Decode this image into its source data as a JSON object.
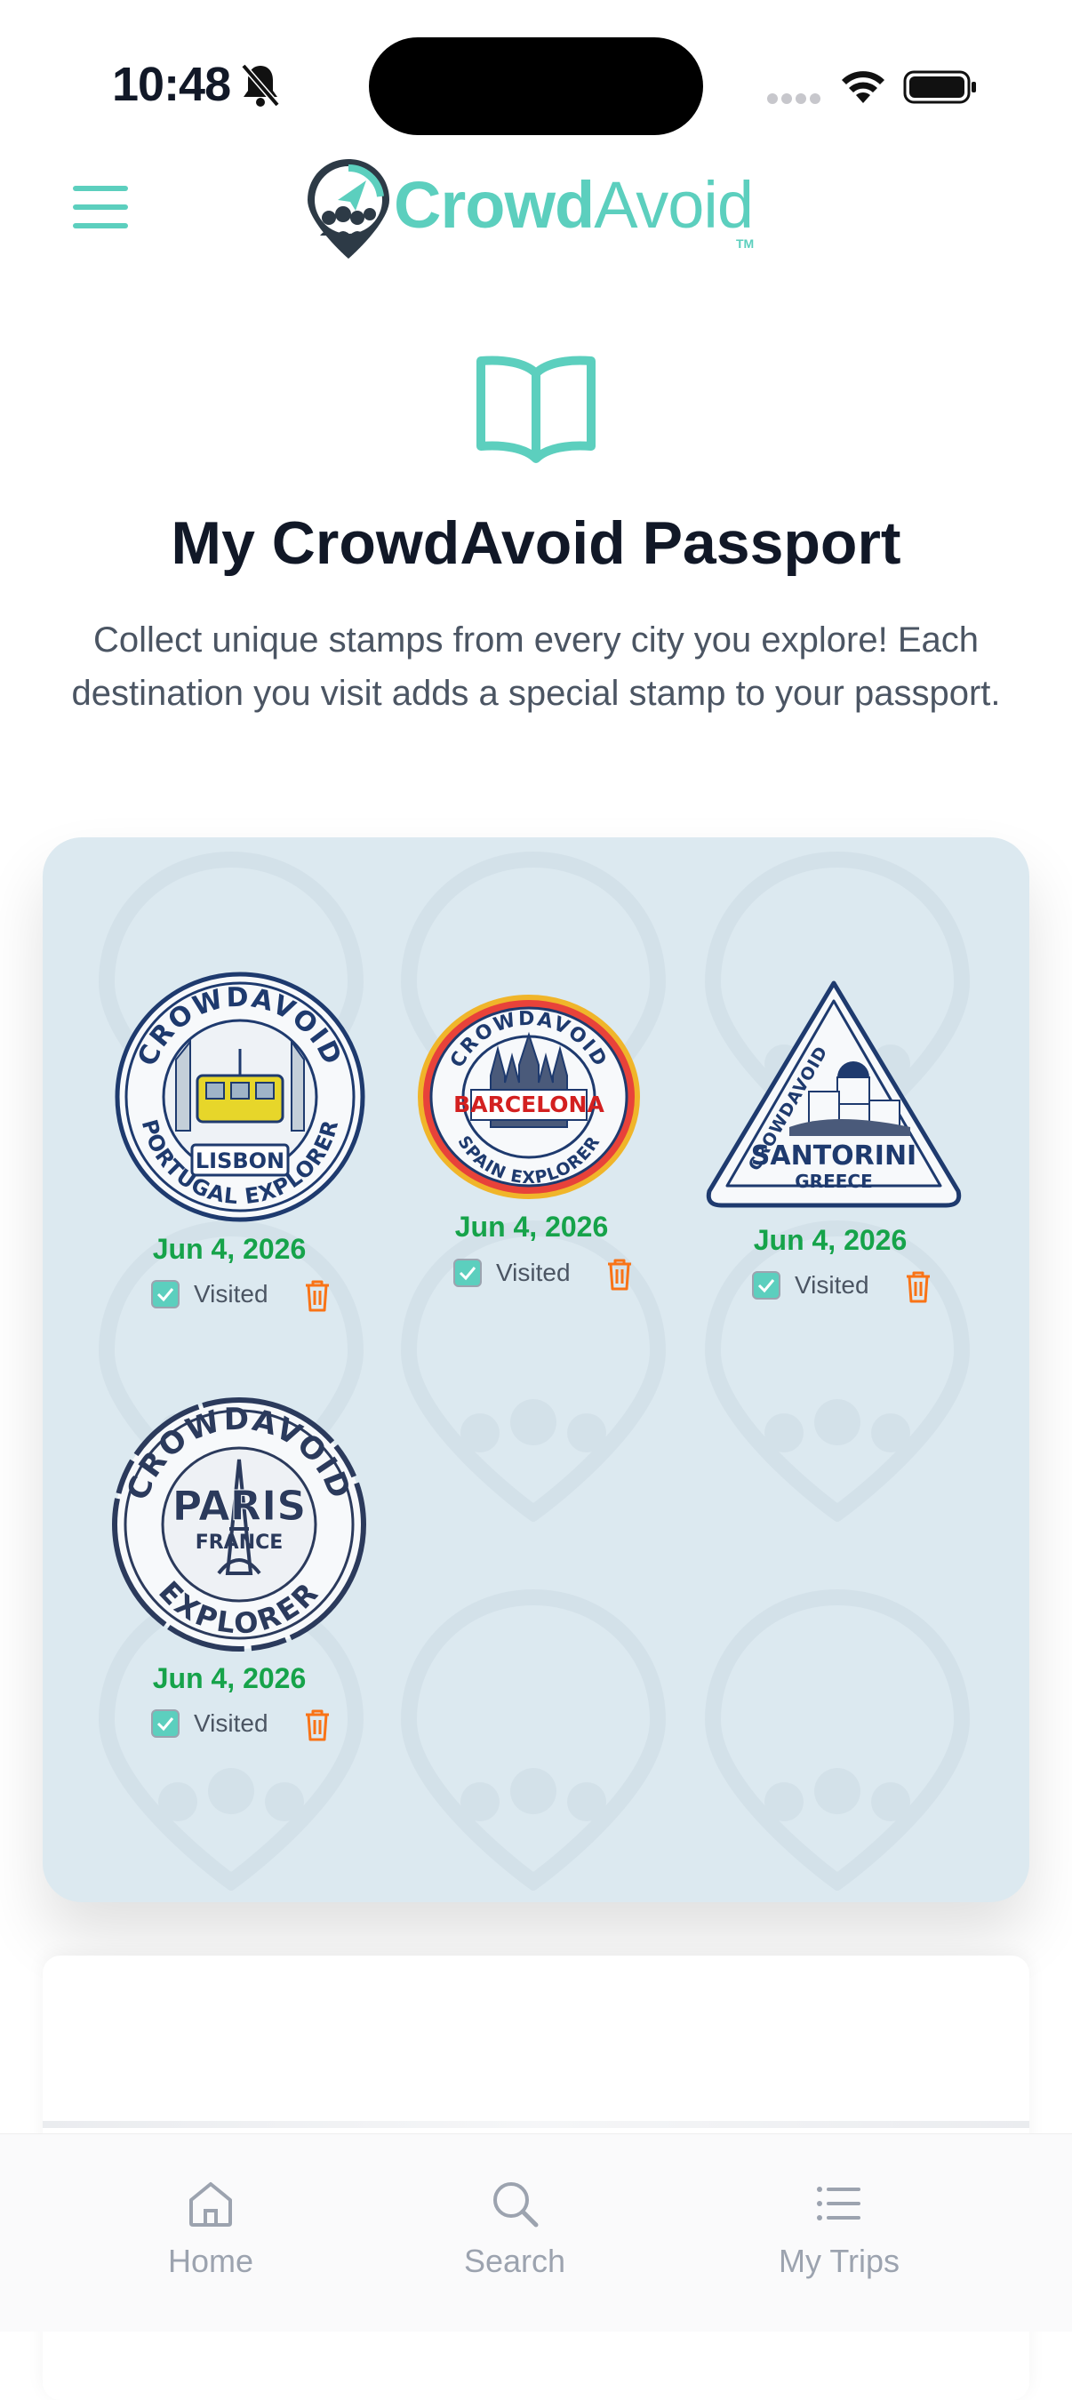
{
  "status_bar": {
    "time": "10:48"
  },
  "header": {
    "brand_part1": "Crowd",
    "brand_part2": "Avoid",
    "trademark": "TM"
  },
  "hero": {
    "title": "My CrowdAvoid Passport",
    "description": "Collect unique stamps from every city you explore! Each destination you visit adds a special stamp to your passport."
  },
  "stamps": [
    {
      "city": "LISBON",
      "arc_top": "CROWDAVOID",
      "arc_bottom": "PORTUGAL EXPLORER",
      "date": "Jun 4, 2026",
      "visited_label": "Visited",
      "visited": true
    },
    {
      "city": "BARCELONA",
      "arc_top": "CROWDAVOID",
      "arc_bottom": "SPAIN EXPLORER",
      "date": "Jun 4, 2026",
      "visited_label": "Visited",
      "visited": true
    },
    {
      "city": "SANTORINI",
      "arc_top": "CROWDAVOID",
      "subtitle": "GREECE",
      "date": "Jun 4, 2026",
      "visited_label": "Visited",
      "visited": true
    },
    {
      "city": "PARIS",
      "arc_top": "CROWDAVOID",
      "subtitle": "FRANCE",
      "arc_bottom": "EXPLORER",
      "date": "Jun 4, 2026",
      "visited_label": "Visited",
      "visited": true
    }
  ],
  "bottom_nav": {
    "items": [
      {
        "label": "Home",
        "icon": "home-icon"
      },
      {
        "label": "Search",
        "icon": "search-icon"
      },
      {
        "label": "My Trips",
        "icon": "list-icon"
      }
    ]
  },
  "colors": {
    "brand": "#5ccfbe",
    "date_green": "#16a34a",
    "trash_orange": "#f97316",
    "card_bg": "#dce9f0",
    "stamp_navy": "#1e3a6e"
  }
}
